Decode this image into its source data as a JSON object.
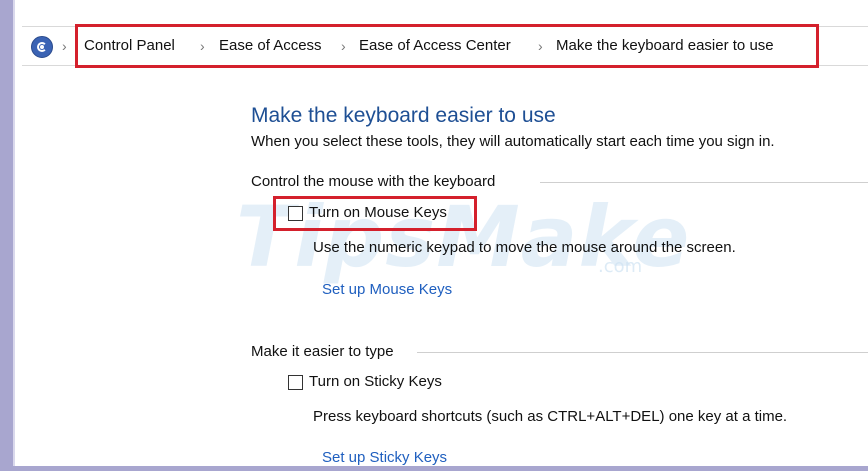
{
  "breadcrumb": {
    "items": [
      "Control Panel",
      "Ease of Access",
      "Ease of Access Center",
      "Make the keyboard easier to use"
    ],
    "separator": "›"
  },
  "page": {
    "title": "Make the keyboard easier to use",
    "subtitle": "When you select these tools, they will automatically start each time you sign in."
  },
  "groups": [
    {
      "label": "Control the mouse with the keyboard",
      "checkbox_label": "Turn on Mouse Keys",
      "checked": false,
      "description": "Use the numeric keypad to move the mouse around the screen.",
      "link": "Set up Mouse Keys"
    },
    {
      "label": "Make it easier to type",
      "checkbox_label": "Turn on Sticky Keys",
      "checked": false,
      "description": "Press keyboard shortcuts (such as CTRL+ALT+DEL) one key at a time.",
      "link": "Set up Sticky Keys"
    }
  ],
  "watermark": {
    "text": "TipsMake",
    "suffix": ".com"
  },
  "colors": {
    "title": "#1e4f94",
    "link": "#1f5fbf",
    "highlight": "#d4202c",
    "frame": "#a8a6cf"
  }
}
